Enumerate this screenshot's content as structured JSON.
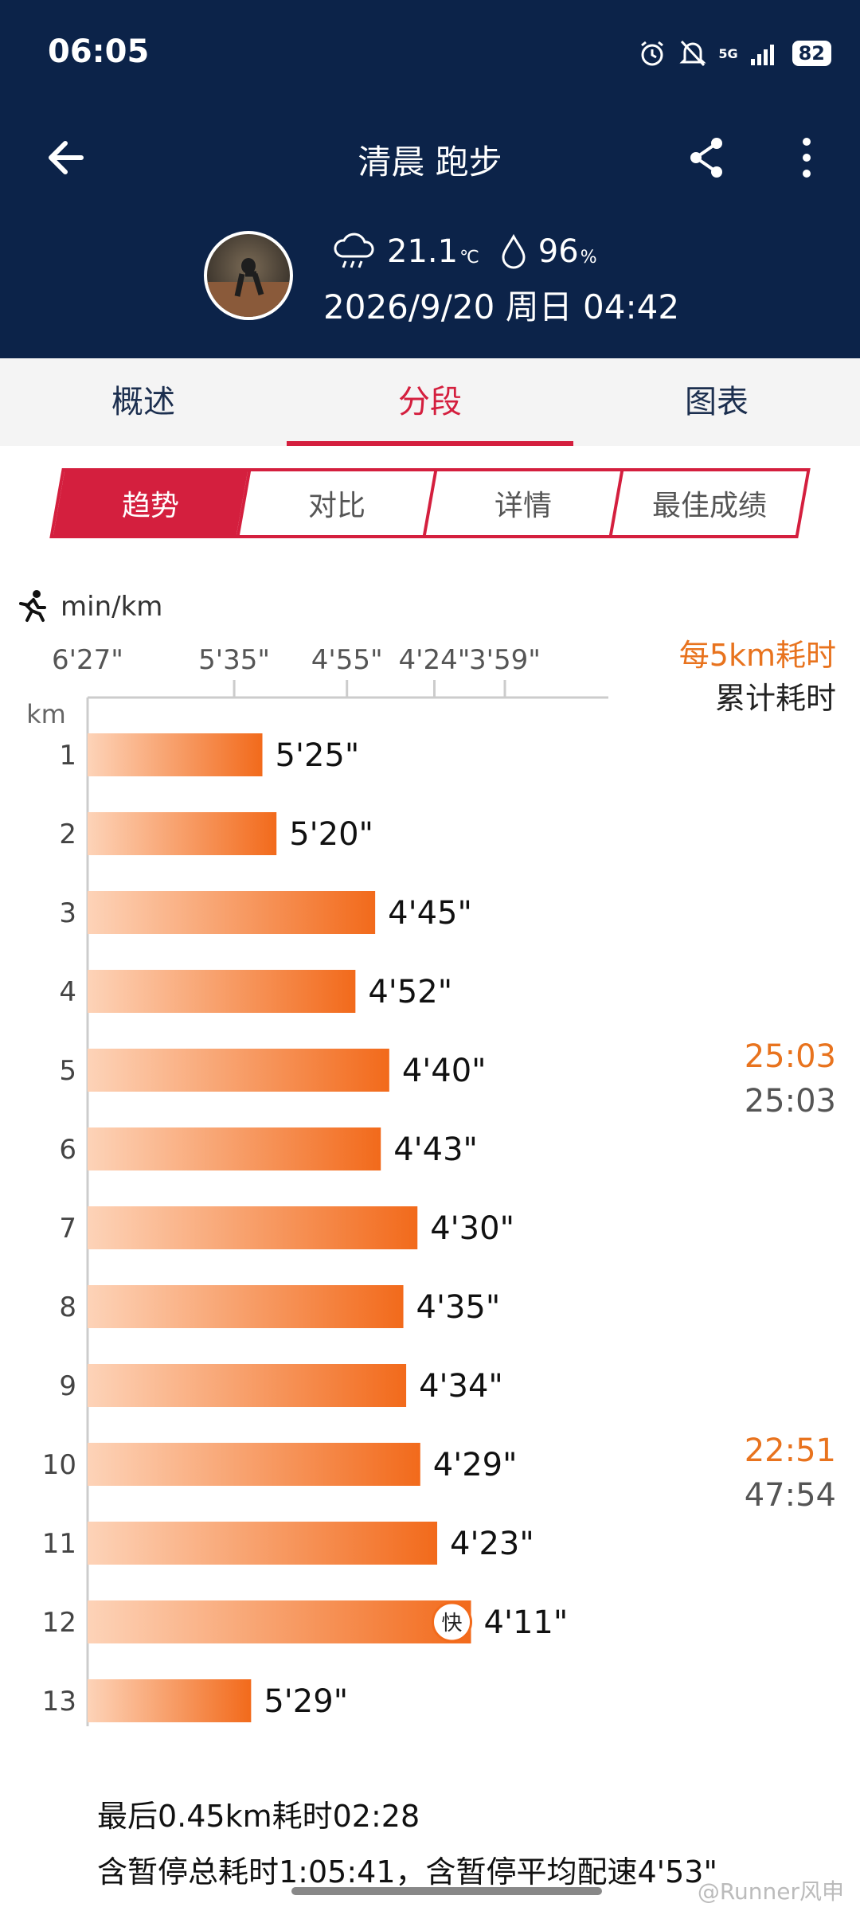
{
  "status": {
    "time": "06:05",
    "network": "5G",
    "battery": "82"
  },
  "header": {
    "title": "清晨 跑步",
    "temperature": "21.1",
    "temp_unit": "℃",
    "humidity": "96",
    "humidity_unit": "%",
    "datetime": "2026/9/20 周日 04:42"
  },
  "tabs": [
    {
      "label": "概述"
    },
    {
      "label": "分段"
    },
    {
      "label": "图表"
    }
  ],
  "subtabs": [
    {
      "label": "趋势"
    },
    {
      "label": "对比"
    },
    {
      "label": "详情"
    },
    {
      "label": "最佳成绩"
    }
  ],
  "chart_data": {
    "type": "bar",
    "unit_label": "min/km",
    "km_label": "km",
    "x_ticks": [
      "6'27\"",
      "5'35\"",
      "4'55\"",
      "4'24\"",
      "3'59\""
    ],
    "x_tick_seconds": [
      387,
      335,
      295,
      264,
      239
    ],
    "categories": [
      "1",
      "2",
      "3",
      "4",
      "5",
      "6",
      "7",
      "8",
      "9",
      "10",
      "11",
      "12",
      "13"
    ],
    "values_label": [
      "5'25\"",
      "5'20\"",
      "4'45\"",
      "4'52\"",
      "4'40\"",
      "4'43\"",
      "4'30\"",
      "4'35\"",
      "4'34\"",
      "4'29\"",
      "4'23\"",
      "4'11\"",
      "5'29\""
    ],
    "values_seconds": [
      325,
      320,
      285,
      292,
      280,
      283,
      270,
      275,
      274,
      269,
      263,
      251,
      329
    ],
    "fastest_marker": "快",
    "fastest_index": 11
  },
  "split_legend": {
    "per5_label": "每5km耗时",
    "cumulative_label": "累计耗时"
  },
  "splits": [
    {
      "after_km": "5",
      "per5": "25:03",
      "cumulative": "25:03"
    },
    {
      "after_km": "10",
      "per5": "22:51",
      "cumulative": "47:54"
    }
  ],
  "footer": {
    "line1": "最后0.45km耗时02:28",
    "line2": "含暂停总耗时1:05:41，含暂停平均配速4'53\""
  },
  "watermark": "@Runner风申",
  "colors": {
    "header_bg": "#0c2349",
    "accent": "#d41f3e",
    "bar_orange": "#f26a1b",
    "bar_light": "#fdd3b8",
    "split_orange": "#e8731e"
  }
}
